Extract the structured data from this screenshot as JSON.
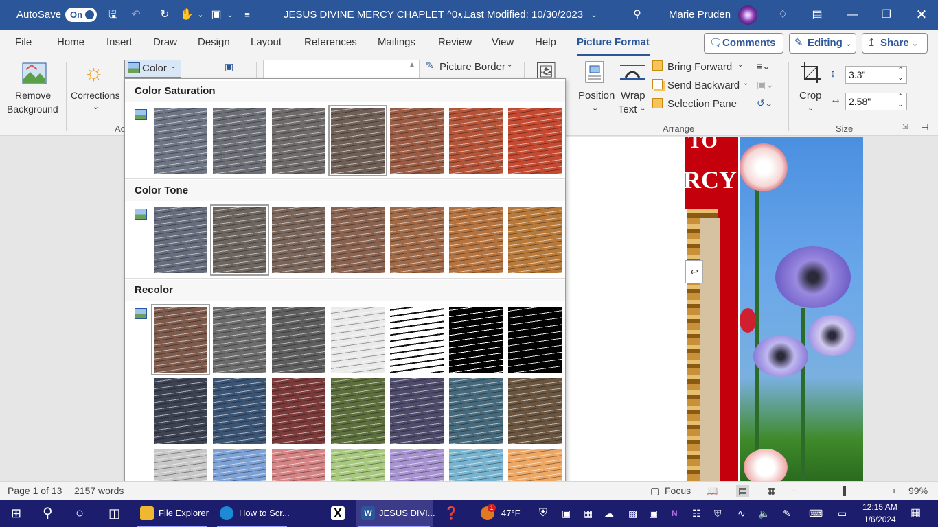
{
  "titlebar": {
    "autosave_label": "AutoSave",
    "autosave_state": "On",
    "doc_title": "JESUS DIVINE MERCY CHAPLET ^0...",
    "last_modified": "• Last Modified: 10/30/2023",
    "user_name": "Marie Pruden"
  },
  "tabs": [
    "File",
    "Home",
    "Insert",
    "Draw",
    "Design",
    "Layout",
    "References",
    "Mailings",
    "Review",
    "View",
    "Help",
    "Picture Format"
  ],
  "top_buttons": {
    "comments": "Comments",
    "editing": "Editing",
    "share": "Share"
  },
  "ribbon": {
    "remove_bg_line1": "Remove",
    "remove_bg_line2": "Background",
    "corrections": "Corrections",
    "color": "Color",
    "adjust_group_partial": "Ac",
    "picture_border": "Picture Border",
    "position": "Position",
    "wrap_line1": "Wrap",
    "wrap_line2": "Text",
    "bring_forward": "Bring Forward",
    "send_backward": "Send Backward",
    "selection_pane": "Selection Pane",
    "arrange_label": "Arrange",
    "crop": "Crop",
    "height_value": "3.3\"",
    "width_value": "2.58\"",
    "size_label": "Size"
  },
  "color_panel": {
    "saturation_heading": "Color Saturation",
    "tone_heading": "Color Tone",
    "recolor_heading": "Recolor",
    "saturation_swatches": [
      "#6e7584",
      "#6c6f76",
      "#6f6b6a",
      "#6e6056",
      "#9a5c44",
      "#b4553a",
      "#c44a32"
    ],
    "saturation_selected": 3,
    "tone_swatches": [
      "#676d7c",
      "#6d6560",
      "#7a655b",
      "#8a6350",
      "#a06a48",
      "#b5733f",
      "#b87a3a"
    ],
    "tone_selected": 1,
    "recolor_row1": [
      "#7d5a4c",
      "#6c6c6c",
      "#5e5e5e",
      "#eaeaea",
      "bw1",
      "bw2",
      "bw3"
    ],
    "recolor_row2": [
      "#3c4252",
      "#3b5474",
      "#7a3a3a",
      "#5c6e3c",
      "#4e4a6a",
      "#466a7c",
      "#6a5640"
    ],
    "recolor_row3": [
      "#c8c8c8",
      "#7ea2d6",
      "#d48484",
      "#a8c880",
      "#a693d0",
      "#78b4d0",
      "#eea866"
    ],
    "recolor_selected": 0
  },
  "document": {
    "band_text_1": "TO",
    "band_text_2": "RCY"
  },
  "statusbar": {
    "page": "Page 1 of 13",
    "words": "2157 words",
    "focus": "Focus",
    "zoom": "99%"
  },
  "taskbar": {
    "file_explorer": "File Explorer",
    "edge": "How to Scr...",
    "word": "JESUS DIVI...",
    "weather": "47°F",
    "weather_badge": "1",
    "time": "12:15 AM",
    "date": "1/6/2024"
  }
}
